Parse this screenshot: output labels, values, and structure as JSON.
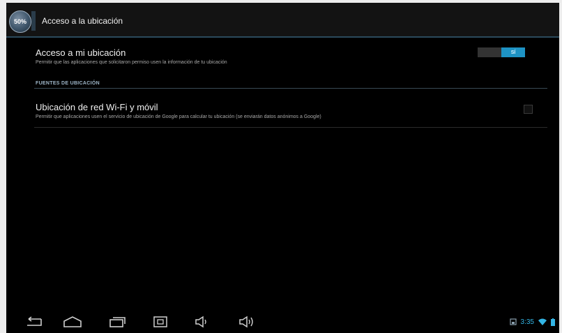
{
  "action_bar": {
    "app_icon_text": "50%",
    "title": "Acceso a la ubicación"
  },
  "preferences": {
    "location_access": {
      "title": "Acceso a mi ubicación",
      "summary": "Permitir que las aplicaciones que solicitaron permiso usen la información de tu ubicación",
      "toggle_label": "SÍ",
      "enabled": true
    },
    "section_header": "FUENTES DE UBICACIÓN",
    "wifi_location": {
      "title": "Ubicación de red Wi-Fi y móvil",
      "summary": "Permitir que aplicaciones usen el servicio de ubicación de Google para calcular tu ubicación (se enviarán datos anónimos a Google)",
      "checked": false
    }
  },
  "nav_bar": {
    "buttons": [
      "back-icon",
      "home-icon",
      "recent-apps-icon",
      "screenshot-icon",
      "volume-down-icon",
      "volume-up-icon"
    ]
  },
  "status_bar": {
    "time": "3:35",
    "icons": [
      "notification-icon",
      "wifi-icon",
      "battery-icon"
    ]
  },
  "colors": {
    "accent": "#33b5e5",
    "toggle_on": "#1e93c4",
    "background": "#000000"
  }
}
